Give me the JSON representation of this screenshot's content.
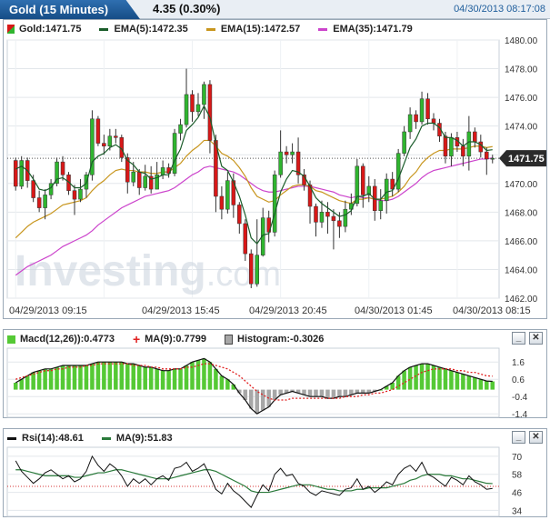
{
  "header": {
    "title": "Gold (15 Minutes)",
    "change": "4.35 (0.30%)",
    "datetime": "04/30/2013 08:17:08"
  },
  "main_legend": {
    "price": "Gold:1471.75",
    "ema5": "EMA(5):1472.35",
    "ema15": "EMA(15):1472.57",
    "ema35": "EMA(35):1471.79"
  },
  "watermark": {
    "brand": "Investing",
    "suffix": ".com"
  },
  "current_price_label": "1471.75",
  "macd_legend": {
    "macd": "Macd(12,26)):0.4773",
    "ma": "MA(9):0.7799",
    "hist": "Histogram:-0.3026"
  },
  "rsi_legend": {
    "rsi": "Rsi(14):48.61",
    "ma": "MA(9):51.83"
  },
  "buttons": {
    "minimize": "_",
    "close": "✕"
  },
  "colors": {
    "up": "#2fb52f",
    "down": "#d81818",
    "ema5": "#1a5c2a",
    "ema15": "#c8961e",
    "ema35": "#cc44cc",
    "macd_bar": "#55c935",
    "macd_neg": "#a7a7a7",
    "signal": "#e02020",
    "rsi": "#111111",
    "rsi_ma": "#2a7a3a"
  },
  "chart_data": [
    {
      "type": "candlestick",
      "title": "Gold (15 Minutes)",
      "ylim": [
        1462,
        1480
      ],
      "y_ticks": [
        "1480.00",
        "1478.00",
        "1476.00",
        "1474.00",
        "1472.00",
        "1470.00",
        "1468.00",
        "1466.00",
        "1464.00",
        "1462.00"
      ],
      "x_ticks": [
        "04/29/2013 09:15",
        "04/29/2013 15:45",
        "04/29/2013 20:45",
        "04/30/2013 01:45",
        "04/30/2013 08:15"
      ],
      "last_price": 1471.75,
      "candles": [
        [
          1471.6,
          1469.8,
          1471.8,
          1469.5
        ],
        [
          1469.8,
          1471.6,
          1471.9,
          1469.6
        ],
        [
          1471.6,
          1470.2,
          1471.8,
          1469.7
        ],
        [
          1470.2,
          1469.0,
          1470.6,
          1468.7
        ],
        [
          1469.0,
          1468.3,
          1469.5,
          1468.0
        ],
        [
          1468.3,
          1469.2,
          1469.6,
          1467.5
        ],
        [
          1469.2,
          1470.0,
          1470.3,
          1468.9
        ],
        [
          1470.0,
          1471.5,
          1471.8,
          1469.8
        ],
        [
          1471.5,
          1470.6,
          1471.9,
          1470.2
        ],
        [
          1470.6,
          1469.5,
          1470.8,
          1469.2
        ],
        [
          1469.5,
          1468.9,
          1469.9,
          1467.8
        ],
        [
          1468.9,
          1469.6,
          1470.3,
          1468.7
        ],
        [
          1469.6,
          1470.6,
          1470.8,
          1469.0
        ],
        [
          1470.6,
          1474.5,
          1475.1,
          1470.2
        ],
        [
          1474.5,
          1472.8,
          1474.7,
          1472.6
        ],
        [
          1472.8,
          1472.6,
          1473.4,
          1472.0
        ],
        [
          1472.6,
          1473.3,
          1473.8,
          1472.3
        ],
        [
          1473.3,
          1473.2,
          1473.8,
          1472.8
        ],
        [
          1473.2,
          1471.8,
          1473.4,
          1471.5
        ],
        [
          1471.8,
          1470.1,
          1472.1,
          1469.3
        ],
        [
          1470.1,
          1470.8,
          1471.5,
          1469.8
        ],
        [
          1470.8,
          1469.7,
          1471.0,
          1469.2
        ],
        [
          1469.7,
          1470.5,
          1471.3,
          1469.5
        ],
        [
          1470.5,
          1469.6,
          1471.2,
          1469.3
        ],
        [
          1469.6,
          1470.6,
          1471.5,
          1469.6
        ],
        [
          1470.6,
          1471.1,
          1471.6,
          1470.3
        ],
        [
          1471.1,
          1470.7,
          1471.4,
          1470.4
        ],
        [
          1470.7,
          1473.5,
          1473.8,
          1470.5
        ],
        [
          1473.5,
          1474.1,
          1474.5,
          1473.0
        ],
        [
          1474.1,
          1476.2,
          1478.0,
          1473.9
        ],
        [
          1476.2,
          1475.0,
          1476.5,
          1474.3
        ],
        [
          1475.0,
          1475.5,
          1476.3,
          1474.7
        ],
        [
          1475.5,
          1476.9,
          1477.1,
          1474.5
        ],
        [
          1476.9,
          1473.0,
          1477.2,
          1472.1
        ],
        [
          1473.0,
          1469.1,
          1473.4,
          1468.0
        ],
        [
          1469.1,
          1468.2,
          1469.8,
          1467.5
        ],
        [
          1468.2,
          1470.2,
          1470.8,
          1467.9
        ],
        [
          1470.2,
          1468.5,
          1470.7,
          1467.6
        ],
        [
          1468.5,
          1467.2,
          1468.7,
          1466.5
        ],
        [
          1467.2,
          1465.1,
          1467.5,
          1464.6
        ],
        [
          1465.1,
          1463.0,
          1465.4,
          1462.7
        ],
        [
          1463.0,
          1465.0,
          1467.5,
          1462.8
        ],
        [
          1465.0,
          1467.6,
          1468.3,
          1464.9
        ],
        [
          1467.6,
          1466.6,
          1468.1,
          1465.9
        ],
        [
          1466.6,
          1470.6,
          1470.9,
          1466.3
        ],
        [
          1470.6,
          1472.2,
          1473.7,
          1470.4
        ],
        [
          1472.2,
          1472.0,
          1472.6,
          1471.4
        ],
        [
          1472.0,
          1472.2,
          1472.8,
          1471.4
        ],
        [
          1472.2,
          1470.6,
          1473.2,
          1470.0
        ],
        [
          1470.6,
          1469.9,
          1471.0,
          1469.5
        ],
        [
          1469.9,
          1468.4,
          1470.2,
          1467.2
        ],
        [
          1468.4,
          1467.3,
          1468.6,
          1466.3
        ],
        [
          1467.3,
          1468.0,
          1468.8,
          1466.9
        ],
        [
          1468.0,
          1467.7,
          1468.7,
          1466.5
        ],
        [
          1467.7,
          1467.4,
          1468.2,
          1465.4
        ],
        [
          1467.4,
          1467.0,
          1468.0,
          1466.2
        ],
        [
          1467.0,
          1468.2,
          1468.8,
          1466.6
        ],
        [
          1468.2,
          1468.6,
          1469.3,
          1467.8
        ],
        [
          1468.6,
          1471.2,
          1471.7,
          1468.4
        ],
        [
          1471.2,
          1469.2,
          1471.4,
          1468.3
        ],
        [
          1469.2,
          1469.8,
          1470.5,
          1468.7
        ],
        [
          1469.8,
          1468.1,
          1470.3,
          1467.4
        ],
        [
          1468.1,
          1468.8,
          1469.6,
          1467.5
        ],
        [
          1468.8,
          1470.3,
          1470.7,
          1467.9
        ],
        [
          1470.3,
          1469.6,
          1470.8,
          1469.1
        ],
        [
          1469.6,
          1472.1,
          1472.4,
          1469.4
        ],
        [
          1472.1,
          1473.6,
          1474.0,
          1471.9
        ],
        [
          1473.6,
          1474.8,
          1475.3,
          1473.1
        ],
        [
          1474.8,
          1474.3,
          1475.1,
          1473.8
        ],
        [
          1474.3,
          1475.9,
          1476.4,
          1474.1
        ],
        [
          1475.9,
          1474.5,
          1476.3,
          1474.1
        ],
        [
          1474.5,
          1474.2,
          1474.9,
          1473.7
        ],
        [
          1474.2,
          1473.3,
          1474.5,
          1472.9
        ],
        [
          1473.3,
          1471.9,
          1473.6,
          1471.4
        ],
        [
          1471.9,
          1473.2,
          1473.5,
          1471.2
        ],
        [
          1473.2,
          1472.6,
          1473.6,
          1472.2
        ],
        [
          1472.6,
          1471.9,
          1473.1,
          1471.2
        ],
        [
          1471.9,
          1473.6,
          1474.7,
          1470.9
        ],
        [
          1473.6,
          1472.9,
          1473.9,
          1472.5
        ],
        [
          1472.9,
          1472.2,
          1473.4,
          1471.8
        ],
        [
          1472.2,
          1471.7,
          1472.5,
          1470.6
        ],
        [
          1471.7,
          1471.75,
          1472.0,
          1471.4
        ]
      ],
      "ema5": [
        1471.0,
        1471.2,
        1470.9,
        1470.3,
        1469.6,
        1469.5,
        1469.7,
        1470.3,
        1470.4,
        1470.1,
        1469.7,
        1469.7,
        1470.0,
        1471.5,
        1471.9,
        1472.1,
        1472.5,
        1472.7,
        1472.4,
        1471.6,
        1471.3,
        1470.8,
        1470.7,
        1470.3,
        1470.4,
        1470.6,
        1470.6,
        1471.6,
        1472.4,
        1473.7,
        1474.1,
        1474.6,
        1475.4,
        1474.6,
        1472.8,
        1471.2,
        1470.9,
        1470.1,
        1469.1,
        1467.8,
        1466.2,
        1465.8,
        1466.4,
        1466.5,
        1467.9,
        1469.4,
        1470.3,
        1470.9,
        1470.8,
        1470.5,
        1469.8,
        1469.0,
        1468.6,
        1468.3,
        1468.0,
        1467.7,
        1467.8,
        1468.1,
        1469.1,
        1469.1,
        1469.3,
        1468.9,
        1468.9,
        1469.4,
        1469.5,
        1470.3,
        1471.4,
        1472.5,
        1473.1,
        1474.0,
        1474.2,
        1474.2,
        1473.9,
        1473.2,
        1473.2,
        1473.0,
        1472.6,
        1472.9,
        1472.9,
        1472.7,
        1472.3,
        1472.35
      ],
      "ema15": [
        1466.2,
        1466.6,
        1467.0,
        1467.3,
        1467.5,
        1467.7,
        1467.9,
        1468.2,
        1468.5,
        1468.6,
        1468.7,
        1468.8,
        1469.0,
        1469.5,
        1469.9,
        1470.2,
        1470.6,
        1470.9,
        1471.0,
        1470.9,
        1470.9,
        1470.8,
        1470.8,
        1470.7,
        1470.7,
        1470.8,
        1470.8,
        1471.1,
        1471.4,
        1471.9,
        1472.3,
        1472.6,
        1473.0,
        1473.0,
        1472.6,
        1472.1,
        1471.9,
        1471.6,
        1471.1,
        1470.5,
        1469.7,
        1469.1,
        1468.9,
        1468.7,
        1468.8,
        1469.2,
        1469.5,
        1469.8,
        1469.9,
        1469.9,
        1469.8,
        1469.5,
        1469.4,
        1469.2,
        1469.0,
        1468.8,
        1468.7,
        1468.6,
        1468.9,
        1468.9,
        1469.0,
        1468.9,
        1468.9,
        1469.0,
        1469.1,
        1469.4,
        1469.8,
        1470.4,
        1470.8,
        1471.4,
        1471.8,
        1472.1,
        1472.3,
        1472.3,
        1472.4,
        1472.4,
        1472.4,
        1472.5,
        1472.6,
        1472.6,
        1472.5,
        1472.57
      ],
      "ema35": [
        1463.6,
        1463.9,
        1464.2,
        1464.4,
        1464.6,
        1464.8,
        1465.0,
        1465.3,
        1465.6,
        1465.8,
        1466.0,
        1466.2,
        1466.4,
        1466.7,
        1467.1,
        1467.4,
        1467.7,
        1468.0,
        1468.3,
        1468.5,
        1468.7,
        1468.9,
        1469.1,
        1469.2,
        1469.3,
        1469.4,
        1469.5,
        1469.7,
        1470.0,
        1470.3,
        1470.6,
        1470.8,
        1471.1,
        1471.2,
        1471.1,
        1471.0,
        1470.9,
        1470.8,
        1470.6,
        1470.3,
        1470.0,
        1469.7,
        1469.5,
        1469.4,
        1469.4,
        1469.5,
        1469.6,
        1469.7,
        1469.8,
        1469.8,
        1469.8,
        1469.7,
        1469.6,
        1469.5,
        1469.4,
        1469.2,
        1469.1,
        1469.0,
        1469.1,
        1469.0,
        1469.0,
        1468.9,
        1468.8,
        1468.8,
        1468.9,
        1469.1,
        1469.4,
        1469.7,
        1470.0,
        1470.4,
        1470.7,
        1470.9,
        1471.0,
        1471.1,
        1471.2,
        1471.3,
        1471.4,
        1471.5,
        1471.6,
        1471.7,
        1471.7,
        1471.79
      ]
    },
    {
      "type": "bar",
      "title": "Macd(12,26)",
      "ylim": [
        -1.6,
        2.4
      ],
      "y_ticks": [
        "1.6",
        "0.6",
        "-0.4",
        "-1.4"
      ],
      "histogram": [
        0.4,
        0.6,
        0.8,
        1.0,
        1.1,
        1.2,
        1.2,
        1.3,
        1.4,
        1.4,
        1.4,
        1.4,
        1.4,
        1.5,
        1.6,
        1.6,
        1.6,
        1.6,
        1.6,
        1.5,
        1.5,
        1.4,
        1.3,
        1.3,
        1.2,
        1.1,
        1.1,
        1.2,
        1.2,
        1.4,
        1.6,
        1.7,
        1.8,
        1.6,
        1.2,
        0.8,
        0.6,
        0.3,
        -0.2,
        -0.6,
        -1.1,
        -1.4,
        -1.2,
        -1.0,
        -0.6,
        -0.3,
        -0.2,
        -0.1,
        -0.2,
        -0.3,
        -0.4,
        -0.4,
        -0.4,
        -0.5,
        -0.5,
        -0.4,
        -0.4,
        -0.3,
        -0.2,
        -0.2,
        -0.2,
        -0.1,
        0.0,
        0.2,
        0.4,
        0.8,
        1.1,
        1.3,
        1.4,
        1.5,
        1.5,
        1.4,
        1.3,
        1.2,
        1.1,
        1.0,
        0.9,
        0.8,
        0.7,
        0.6,
        0.5,
        0.4773
      ],
      "signal": [
        0.6,
        0.7,
        0.8,
        0.9,
        1.0,
        1.1,
        1.1,
        1.2,
        1.2,
        1.3,
        1.3,
        1.3,
        1.4,
        1.4,
        1.5,
        1.5,
        1.5,
        1.5,
        1.5,
        1.5,
        1.4,
        1.4,
        1.4,
        1.3,
        1.3,
        1.2,
        1.2,
        1.2,
        1.2,
        1.3,
        1.3,
        1.4,
        1.5,
        1.5,
        1.4,
        1.3,
        1.2,
        1.0,
        0.8,
        0.5,
        0.2,
        -0.1,
        -0.3,
        -0.5,
        -0.6,
        -0.6,
        -0.6,
        -0.5,
        -0.5,
        -0.5,
        -0.5,
        -0.5,
        -0.5,
        -0.5,
        -0.5,
        -0.5,
        -0.4,
        -0.4,
        -0.4,
        -0.3,
        -0.3,
        -0.2,
        -0.2,
        -0.1,
        0.0,
        0.2,
        0.4,
        0.6,
        0.8,
        1.0,
        1.1,
        1.2,
        1.2,
        1.2,
        1.2,
        1.1,
        1.1,
        1.0,
        1.0,
        0.9,
        0.8,
        0.7799
      ]
    },
    {
      "type": "line",
      "title": "Rsi(14)",
      "ylim": [
        30,
        76
      ],
      "y_ticks": [
        "70",
        "58",
        "46",
        "34"
      ],
      "rsi": [
        67,
        60,
        56,
        52,
        55,
        59,
        61,
        58,
        55,
        57,
        53,
        55,
        60,
        70,
        64,
        60,
        65,
        62,
        57,
        50,
        55,
        52,
        55,
        51,
        55,
        57,
        54,
        62,
        63,
        66,
        60,
        62,
        65,
        57,
        48,
        45,
        52,
        47,
        44,
        40,
        36,
        44,
        51,
        47,
        58,
        62,
        57,
        58,
        52,
        50,
        46,
        44,
        47,
        46,
        45,
        44,
        48,
        49,
        55,
        48,
        50,
        46,
        49,
        53,
        51,
        58,
        62,
        64,
        60,
        66,
        58,
        56,
        53,
        50,
        56,
        54,
        51,
        57,
        53,
        51,
        48,
        48.61
      ],
      "rsi_ma": [
        61,
        61,
        60,
        59,
        58,
        57,
        57,
        57,
        57,
        57,
        56,
        56,
        57,
        58,
        59,
        59,
        60,
        61,
        61,
        60,
        59,
        58,
        57,
        56,
        55,
        55,
        55,
        56,
        57,
        58,
        59,
        60,
        61,
        61,
        60,
        58,
        56,
        54,
        52,
        50,
        47,
        46,
        46,
        46,
        47,
        48,
        49,
        50,
        51,
        51,
        51,
        50,
        49,
        48,
        48,
        47,
        47,
        47,
        48,
        48,
        49,
        49,
        49,
        49,
        50,
        51,
        52,
        54,
        55,
        57,
        58,
        58,
        58,
        57,
        57,
        56,
        55,
        55,
        54,
        53,
        52,
        51.83
      ]
    }
  ]
}
